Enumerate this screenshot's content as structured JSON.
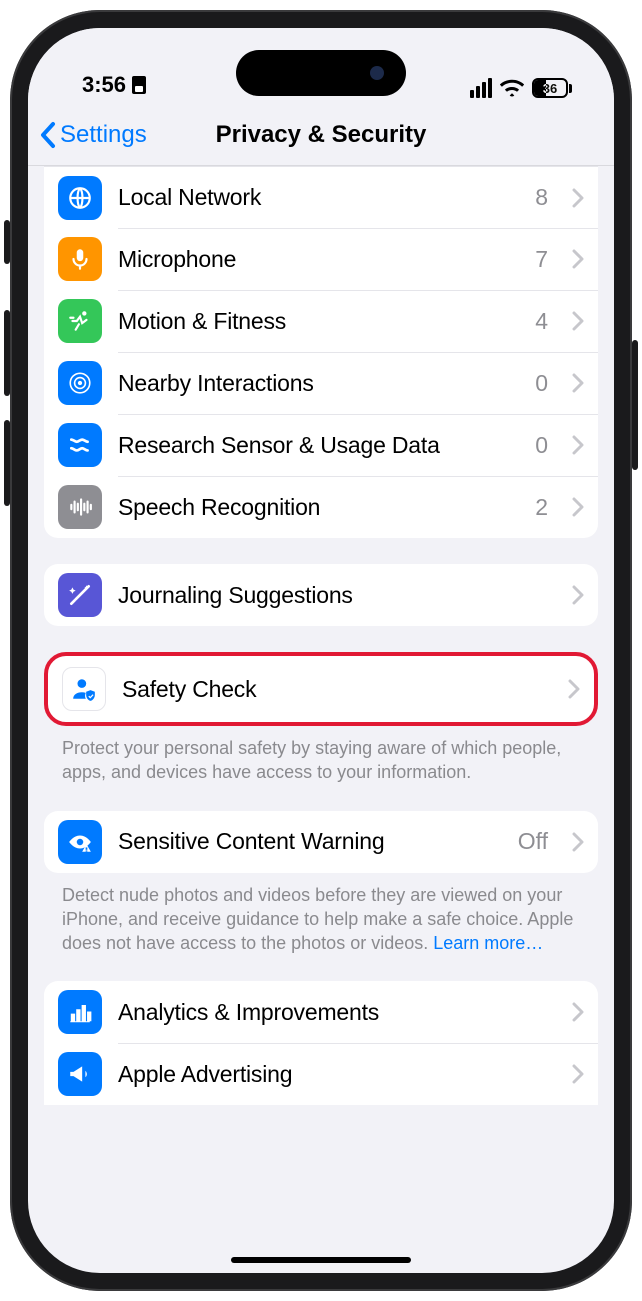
{
  "status": {
    "time": "3:56",
    "battery_pct": "36"
  },
  "nav": {
    "back_label": "Settings",
    "title": "Privacy & Security"
  },
  "group1": [
    {
      "label": "Local Network",
      "value": "8"
    },
    {
      "label": "Microphone",
      "value": "7"
    },
    {
      "label": "Motion & Fitness",
      "value": "4"
    },
    {
      "label": "Nearby Interactions",
      "value": "0"
    },
    {
      "label": "Research Sensor & Usage Data",
      "value": "0"
    },
    {
      "label": "Speech Recognition",
      "value": "2"
    }
  ],
  "group2": [
    {
      "label": "Journaling Suggestions"
    }
  ],
  "group3": [
    {
      "label": "Safety Check"
    }
  ],
  "group3_footer": "Protect your personal safety by staying aware of which people, apps, and devices have access to your information.",
  "group4": [
    {
      "label": "Sensitive Content Warning",
      "value": "Off"
    }
  ],
  "group4_footer": "Detect nude photos and videos before they are viewed on your iPhone, and receive guidance to help make a safe choice. Apple does not have access to the photos or videos. ",
  "group4_footer_link": "Learn more…",
  "group5": [
    {
      "label": "Analytics & Improvements"
    },
    {
      "label": "Apple Advertising"
    }
  ]
}
